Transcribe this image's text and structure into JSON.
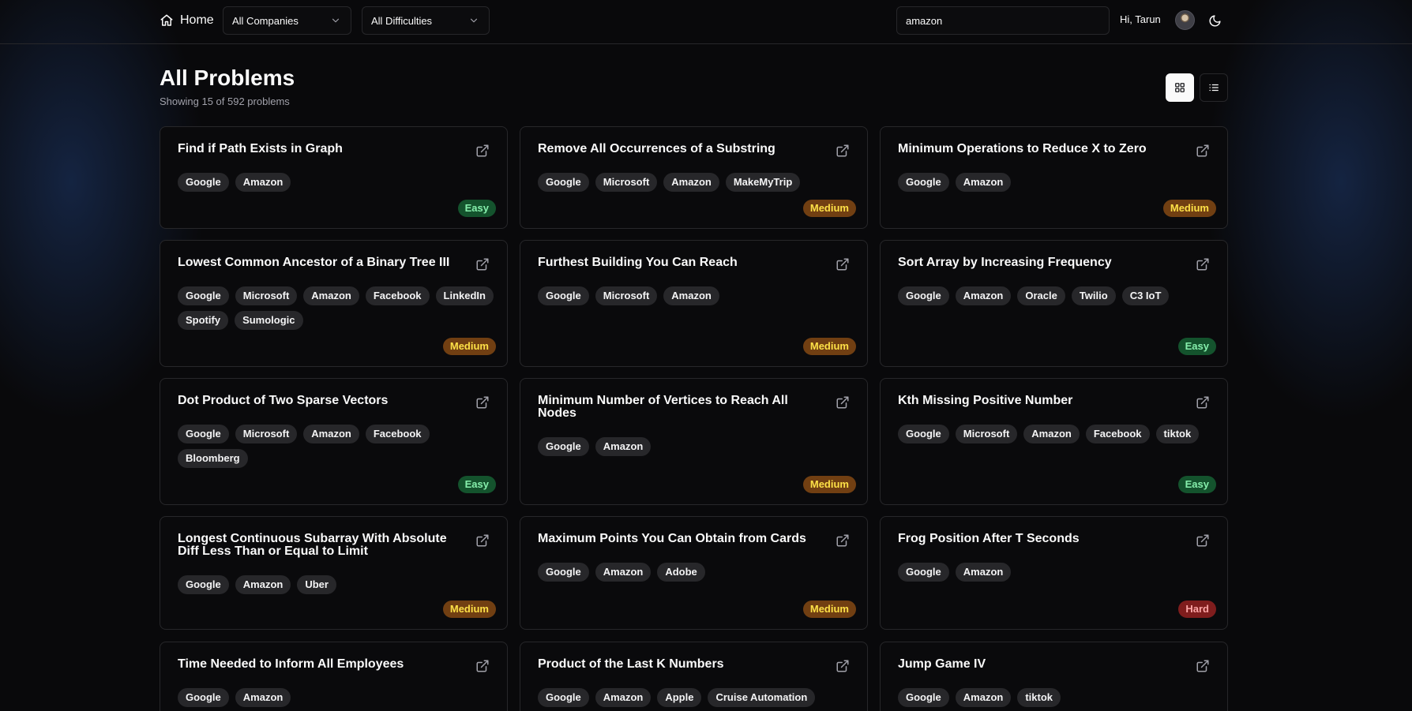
{
  "header": {
    "home_label": "Home",
    "company_filter": "All Companies",
    "difficulty_filter": "All Difficulties",
    "search_value": "amazon",
    "greeting": "Hi, Tarun"
  },
  "main": {
    "title": "All Problems",
    "subtitle": "Showing 15 of 592 problems",
    "view_mode": "grid"
  },
  "problems": [
    {
      "title": "Find if Path Exists in Graph",
      "companies": [
        "Google",
        "Amazon"
      ],
      "difficulty": "Easy"
    },
    {
      "title": "Remove All Occurrences of a Substring",
      "companies": [
        "Google",
        "Microsoft",
        "Amazon",
        "MakeMyTrip"
      ],
      "difficulty": "Medium"
    },
    {
      "title": "Minimum Operations to Reduce X to Zero",
      "companies": [
        "Google",
        "Amazon"
      ],
      "difficulty": "Medium"
    },
    {
      "title": "Lowest Common Ancestor of a Binary Tree III",
      "companies": [
        "Google",
        "Microsoft",
        "Amazon",
        "Facebook",
        "LinkedIn",
        "Spotify",
        "Sumologic"
      ],
      "difficulty": "Medium"
    },
    {
      "title": "Furthest Building You Can Reach",
      "companies": [
        "Google",
        "Microsoft",
        "Amazon"
      ],
      "difficulty": "Medium"
    },
    {
      "title": "Sort Array by Increasing Frequency",
      "companies": [
        "Google",
        "Amazon",
        "Oracle",
        "Twilio",
        "C3 IoT"
      ],
      "difficulty": "Easy"
    },
    {
      "title": "Dot Product of Two Sparse Vectors",
      "companies": [
        "Google",
        "Microsoft",
        "Amazon",
        "Facebook",
        "Bloomberg"
      ],
      "difficulty": "Easy"
    },
    {
      "title": "Minimum Number of Vertices to Reach All Nodes",
      "companies": [
        "Google",
        "Amazon"
      ],
      "difficulty": "Medium"
    },
    {
      "title": "Kth Missing Positive Number",
      "companies": [
        "Google",
        "Microsoft",
        "Amazon",
        "Facebook",
        "tiktok"
      ],
      "difficulty": "Easy"
    },
    {
      "title": "Longest Continuous Subarray With Absolute Diff Less Than or Equal to Limit",
      "companies": [
        "Google",
        "Amazon",
        "Uber"
      ],
      "difficulty": "Medium"
    },
    {
      "title": "Maximum Points You Can Obtain from Cards",
      "companies": [
        "Google",
        "Amazon",
        "Adobe"
      ],
      "difficulty": "Medium"
    },
    {
      "title": "Frog Position After T Seconds",
      "companies": [
        "Google",
        "Amazon"
      ],
      "difficulty": "Hard"
    },
    {
      "title": "Time Needed to Inform All Employees",
      "companies": [
        "Google",
        "Amazon"
      ],
      "difficulty": ""
    },
    {
      "title": "Product of the Last K Numbers",
      "companies": [
        "Google",
        "Amazon",
        "Apple",
        "Cruise Automation"
      ],
      "difficulty": ""
    },
    {
      "title": "Jump Game IV",
      "companies": [
        "Google",
        "Amazon",
        "tiktok"
      ],
      "difficulty": ""
    }
  ]
}
